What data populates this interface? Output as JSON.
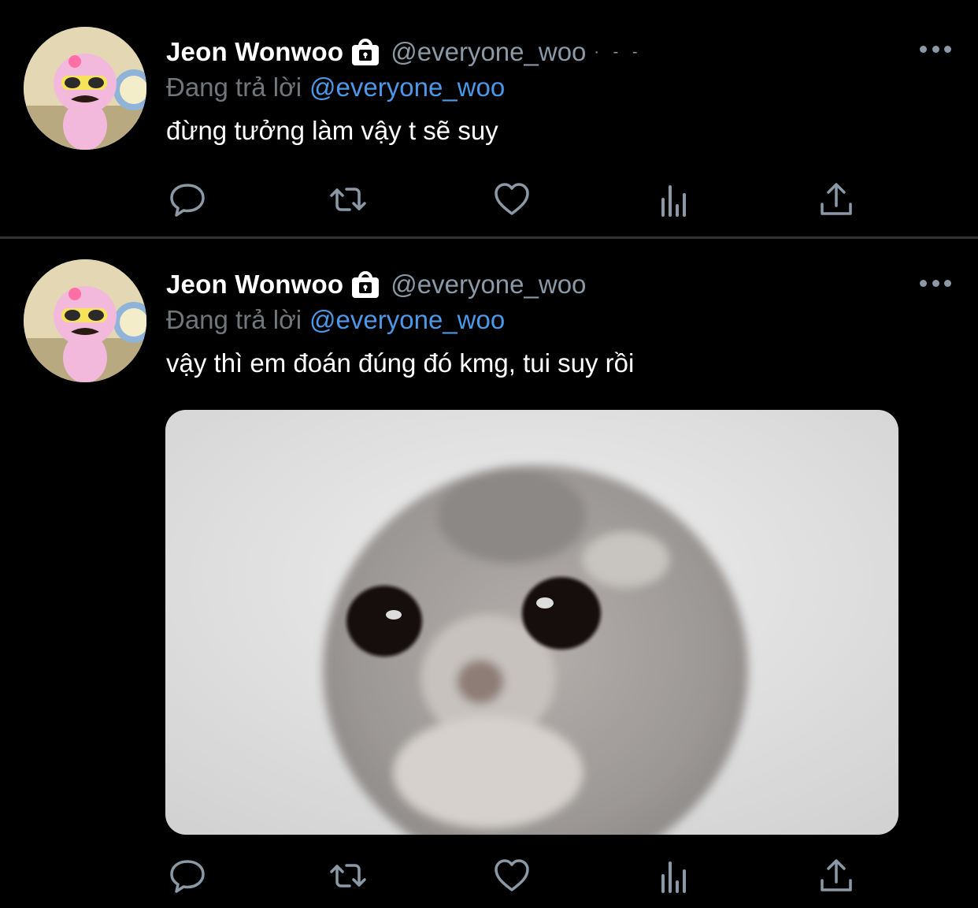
{
  "tweets": [
    {
      "author": {
        "display_name": "Jeon Wonwoo",
        "handle": "@everyone_woo",
        "handle_tail": "· - -",
        "avatar": "pink-sheep-with-sunglasses-mustache",
        "protected_icon": "lock-icon"
      },
      "reply_label": "Đang trả lời",
      "reply_mention": "@everyone_woo",
      "text": "đừng tưởng làm vậy t sẽ suy",
      "actions": [
        "reply-icon",
        "retweet-icon",
        "like-icon",
        "views-icon",
        "share-icon"
      ]
    },
    {
      "author": {
        "display_name": "Jeon Wonwoo",
        "handle": "@everyone_woo",
        "avatar": "pink-sheep-with-sunglasses-mustache",
        "protected_icon": "lock-icon"
      },
      "reply_label": "Đang trả lời",
      "reply_mention": "@everyone_woo",
      "text": "vậy thì em đoán đúng đó kmg, tui suy rồi",
      "media": {
        "type": "image",
        "subject": "sad-hamster-meme"
      },
      "actions": [
        "reply-icon",
        "retweet-icon",
        "like-icon",
        "views-icon",
        "share-icon"
      ]
    }
  ],
  "colors": {
    "background": "#000000",
    "text": "#ffffff",
    "muted": "#71767b",
    "mention": "#4a99e9",
    "divider": "#2f3336"
  }
}
